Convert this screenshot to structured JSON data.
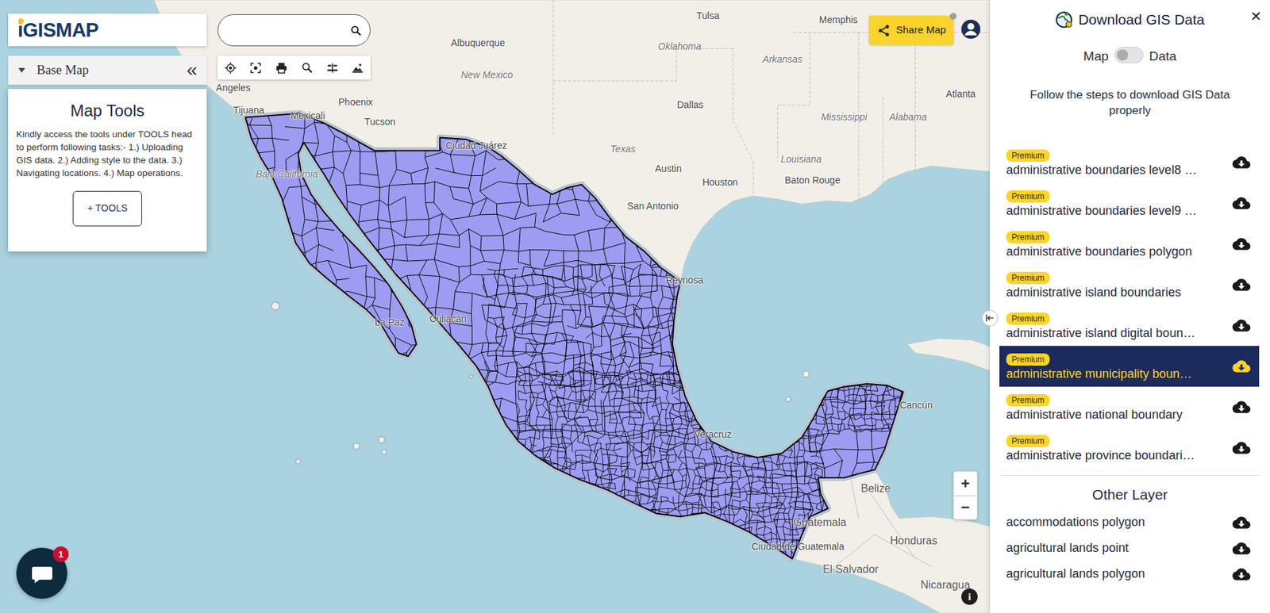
{
  "logo": {
    "mark": "i",
    "text": "GISMAP"
  },
  "search": {
    "value": ""
  },
  "base_map": {
    "label": "Base Map",
    "collapse": "«"
  },
  "map_tools": {
    "title": "Map Tools",
    "description": "Kindly access the tools under TOOLS head to perform following tasks:- 1.) Uploading GIS data. 2.) Adding style to the data. 3.) Navigating locations. 4.) Map operations.",
    "button": "+ TOOLS"
  },
  "share_button": "Share Map",
  "zoom": {
    "in": "+",
    "out": "−"
  },
  "info": "i",
  "chat": {
    "badge": "1"
  },
  "map_labels": [
    {
      "text": "Tulsa",
      "kind": "city"
    },
    {
      "text": "Memphis",
      "kind": "city"
    },
    {
      "text": "Oklahoma",
      "kind": "region"
    },
    {
      "text": "Arkansas",
      "kind": "region"
    },
    {
      "text": "Albuquerque",
      "kind": "city"
    },
    {
      "text": "New Mexico",
      "kind": "region"
    },
    {
      "text": "Dallas",
      "kind": "city"
    },
    {
      "text": "Mississippi",
      "kind": "region"
    },
    {
      "text": "Alabama",
      "kind": "region"
    },
    {
      "text": "Atlanta",
      "kind": "city"
    },
    {
      "text": "Texas",
      "kind": "region"
    },
    {
      "text": "Louisiana",
      "kind": "region"
    },
    {
      "text": "Austin",
      "kind": "city"
    },
    {
      "text": "Houston",
      "kind": "city"
    },
    {
      "text": "Baton Rouge",
      "kind": "city"
    },
    {
      "text": "San Antonio",
      "kind": "city"
    },
    {
      "text": "Angeles",
      "kind": "city"
    },
    {
      "text": "Tijuana",
      "kind": "city"
    },
    {
      "text": "Mexicali",
      "kind": "city"
    },
    {
      "text": "Phoenix",
      "kind": "city"
    },
    {
      "text": "Tucson",
      "kind": "city"
    },
    {
      "text": "Ciudad Juárez",
      "kind": "city"
    },
    {
      "text": "Baja California",
      "kind": "region"
    },
    {
      "text": "La Paz",
      "kind": "city"
    },
    {
      "text": "Culiacán",
      "kind": "city"
    },
    {
      "text": "Reynosa",
      "kind": "city"
    },
    {
      "text": "Veracruz",
      "kind": "city"
    },
    {
      "text": "Cancún",
      "kind": "city"
    },
    {
      "text": "Belize",
      "kind": "country"
    },
    {
      "text": "Guatemala",
      "kind": "country"
    },
    {
      "text": "Ciudad de Guatemala",
      "kind": "city"
    },
    {
      "text": "Honduras",
      "kind": "country"
    },
    {
      "text": "El Salvador",
      "kind": "country"
    },
    {
      "text": "Nicaragua",
      "kind": "country"
    }
  ],
  "panel": {
    "title": "Download GIS Data",
    "close": "✕",
    "toggle": {
      "left": "Map",
      "right": "Data",
      "on": false
    },
    "instructions": "Follow the steps to download GIS Data properly",
    "premium_layers": [
      {
        "badge": "Premium",
        "name": "administrative boundaries level8 …",
        "selected": false
      },
      {
        "badge": "Premium",
        "name": "administrative boundaries level9 …",
        "selected": false
      },
      {
        "badge": "Premium",
        "name": "administrative boundaries polygon",
        "selected": false
      },
      {
        "badge": "Premium",
        "name": "administrative island boundaries",
        "selected": false
      },
      {
        "badge": "Premium",
        "name": "administrative island digital boun…",
        "selected": false
      },
      {
        "badge": "Premium",
        "name": "administrative municipality boun…",
        "selected": true
      },
      {
        "badge": "Premium",
        "name": "administrative national boundary",
        "selected": false
      },
      {
        "badge": "Premium",
        "name": "administrative province boundari…",
        "selected": false
      }
    ],
    "other_heading": "Other Layer",
    "other_layers": [
      {
        "name": "accommodations polygon"
      },
      {
        "name": "agricultural lands point"
      },
      {
        "name": "agricultural lands polygon"
      }
    ]
  }
}
